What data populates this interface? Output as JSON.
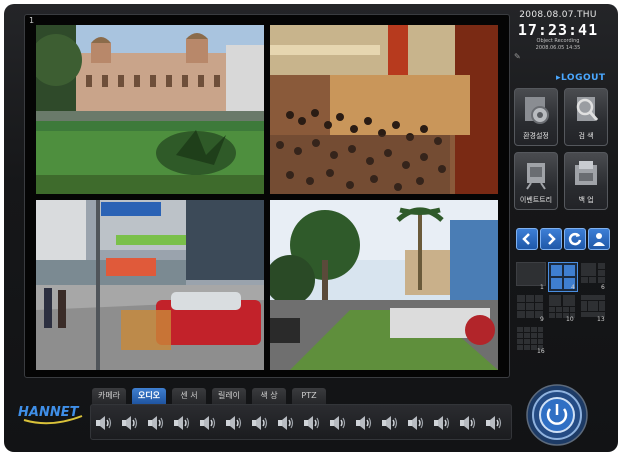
{
  "datetime": {
    "date": "2008.08.07.THU",
    "time": "17:23:41",
    "recording_status": "Object Recording",
    "recording_detail": "2008.06.05 14:35"
  },
  "monitor": {
    "channel_label": "1",
    "cameras": [
      "camera-1-palace",
      "camera-2-crowd",
      "camera-3-street",
      "camera-4-palms"
    ]
  },
  "logout": "▸LOGOUT",
  "menu": {
    "settings": "환경설정",
    "search": "검 색",
    "event_tree": "이벤트트리",
    "backup": "백 업"
  },
  "nav_icons": [
    "chevron-left-icon",
    "chevron-right-icon",
    "refresh-icon",
    "person-icon"
  ],
  "layout_numbers": {
    "one": "1",
    "four": "4",
    "six": "6",
    "nine": "9",
    "ten": "10",
    "thirteen": "13",
    "sixteen": "16"
  },
  "brand": "HANNET",
  "tabs": [
    "카메라",
    "오디오",
    "센 서",
    "릴레이",
    "색 상",
    "PTZ"
  ],
  "active_tab": "오디오",
  "speaker_count": 16,
  "colors": {
    "accent": "#2f6fc4",
    "logout": "#4aa8ff",
    "background": "#161719"
  }
}
